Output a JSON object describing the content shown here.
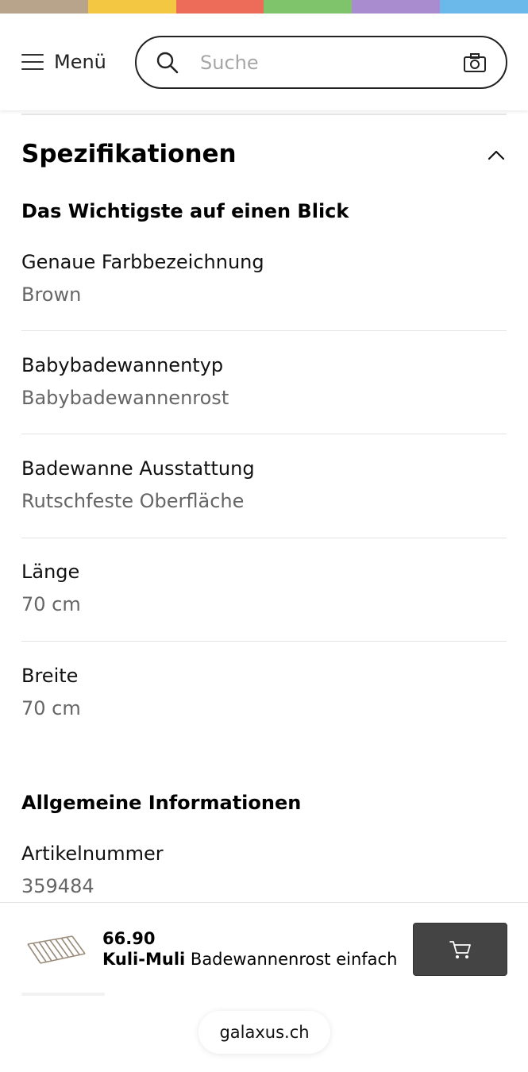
{
  "brand_stripe": [
    "#b8a48a",
    "#f4c742",
    "#ec6b59",
    "#7fc36a",
    "#a98bcf",
    "#6bb8ea"
  ],
  "header": {
    "menu_label": "Menü",
    "menu_icon": "hamburger-icon",
    "search_placeholder": "Suche",
    "search_icon": "search-icon",
    "camera_icon": "camera-icon"
  },
  "section": {
    "title": "Spezifikationen",
    "toggle_icon": "chevron-up-icon"
  },
  "groups": [
    {
      "title": "Das Wichtigste auf einen Blick",
      "specs": [
        {
          "name": "Genaue Farbbezeichnung",
          "value": "Brown"
        },
        {
          "name": "Babybadewannentyp",
          "value": "Babybadewannenrost"
        },
        {
          "name": "Badewanne Ausstattung",
          "value": "Rutschfeste Oberfläche"
        },
        {
          "name": "Länge",
          "value": "70 cm"
        },
        {
          "name": "Breite",
          "value": "70 cm"
        }
      ]
    },
    {
      "title": "Allgemeine Informationen",
      "specs": [
        {
          "name": "Artikelnummer",
          "value": "359484"
        }
      ]
    }
  ],
  "sticky_bar": {
    "price": "66.90",
    "brand": "Kuli-Muli",
    "product_name": "Badewannenrost einfach",
    "cart_icon": "cart-icon",
    "cart_button_color": "#444444"
  },
  "browser": {
    "url": "galaxus.ch"
  }
}
